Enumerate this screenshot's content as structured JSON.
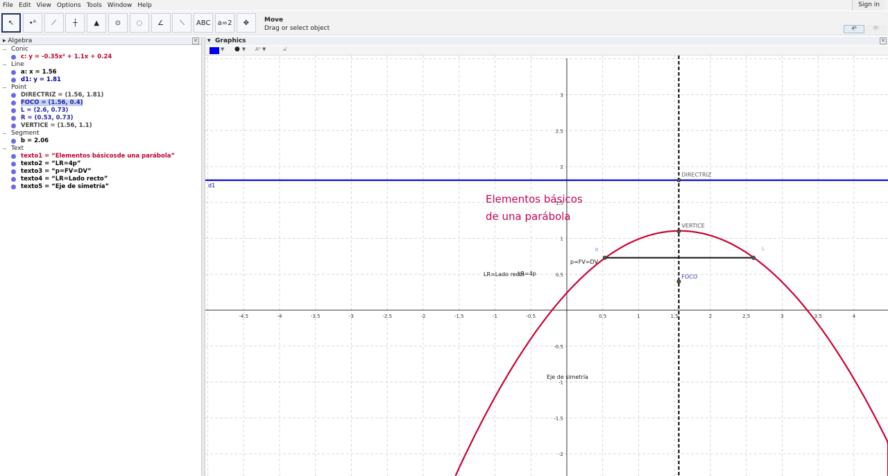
{
  "menu": [
    "File",
    "Edit",
    "View",
    "Options",
    "Tools",
    "Window",
    "Help"
  ],
  "signin": "Sign in",
  "toolbar": {
    "tools": [
      {
        "name": "move-tool",
        "glyph": "↖"
      },
      {
        "name": "point-tool",
        "glyph": "•ᴬ"
      },
      {
        "name": "line-tool",
        "glyph": "⟋"
      },
      {
        "name": "perpendicular-tool",
        "glyph": "┼"
      },
      {
        "name": "polygon-tool",
        "glyph": "▲"
      },
      {
        "name": "circle-tool",
        "glyph": "⊙"
      },
      {
        "name": "conic-tool",
        "glyph": "◌"
      },
      {
        "name": "angle-tool",
        "glyph": "∠"
      },
      {
        "name": "reflect-tool",
        "glyph": "⟍"
      },
      {
        "name": "text-tool",
        "glyph": "ABC"
      },
      {
        "name": "slider-tool",
        "glyph": "a=2"
      },
      {
        "name": "move-view-tool",
        "glyph": "✥"
      }
    ],
    "tool_name": "Move",
    "tool_help": "Drag or select object",
    "undo": "↶",
    "redo": "↷"
  },
  "algebra": {
    "title": "Algebra",
    "groups": [
      {
        "label": "Conic",
        "items": [
          {
            "text": "c: y = -0.35x² + 1.1x + 0.24",
            "color": "#c0002a"
          }
        ]
      },
      {
        "label": "Line",
        "items": [
          {
            "text": "a: x = 1.56",
            "color": "#000000"
          },
          {
            "text": "d1: y = 1.81",
            "color": "#0000b0"
          }
        ]
      },
      {
        "label": "Point",
        "items": [
          {
            "text": "DIRECTRIZ = (1.56, 1.81)",
            "color": "#444444"
          },
          {
            "text": "FOCO = (1.56, 0.4)",
            "color": "#2222aa",
            "hl": true
          },
          {
            "text": "L = (2.6, 0.73)",
            "color": "#2222aa"
          },
          {
            "text": "R = (0.53, 0.73)",
            "color": "#2222aa"
          },
          {
            "text": "VERTICE = (1.56, 1.1)",
            "color": "#444444"
          }
        ]
      },
      {
        "label": "Segment",
        "items": [
          {
            "text": "b = 2.06",
            "color": "#000000"
          }
        ]
      },
      {
        "label": "Text",
        "items": [
          {
            "text": "texto1 = “Elementos básicosde una parábola”",
            "color": "#c0002a"
          },
          {
            "text": "texto2 = “LR=4p”",
            "color": "#000000"
          },
          {
            "text": "texto3 = “p=FV=DV”",
            "color": "#000000"
          },
          {
            "text": "texto4 = “LR=Lado recto”",
            "color": "#000000"
          },
          {
            "text": "texto5 = “Eje de simetría”",
            "color": "#000000"
          }
        ]
      }
    ]
  },
  "graphics": {
    "title": "Graphics",
    "labels": {
      "d1": "d1",
      "directriz": "DIRECTRIZ",
      "vertice": "VERTICE",
      "foco": "FOCO",
      "R": "R",
      "L": "L",
      "title1": "Elementos básicos",
      "title2": "de una parábola",
      "texto2": "LR=4p",
      "texto3": "p=FV=DV",
      "texto4": "LR=Lado recto",
      "texto5": "Eje de simetría"
    },
    "parabola": {
      "a": -0.35,
      "b": 1.1,
      "c": 0.24
    },
    "axis_x": 1.56,
    "directrix_y": 1.81,
    "points": {
      "R": [
        0.53,
        0.73
      ],
      "L": [
        2.6,
        0.73
      ],
      "FOCO": [
        1.56,
        0.4
      ],
      "VERTICE": [
        1.56,
        1.1
      ],
      "DIRECTRIZ": [
        1.56,
        1.81
      ]
    },
    "xticks": [
      -4.5,
      -4,
      -3.5,
      -3,
      -2.5,
      -2,
      -1.5,
      -1,
      -0.5,
      0.5,
      1,
      1.5,
      2,
      2.5,
      3,
      3.5,
      4
    ],
    "yticks": [
      -2,
      -1.5,
      -1,
      -0.5,
      0.5,
      1,
      1.5,
      2,
      2.5,
      3
    ],
    "colors": {
      "parabola": "#cc0033",
      "directrix": "#0000cc",
      "title": "#cc0055"
    }
  }
}
